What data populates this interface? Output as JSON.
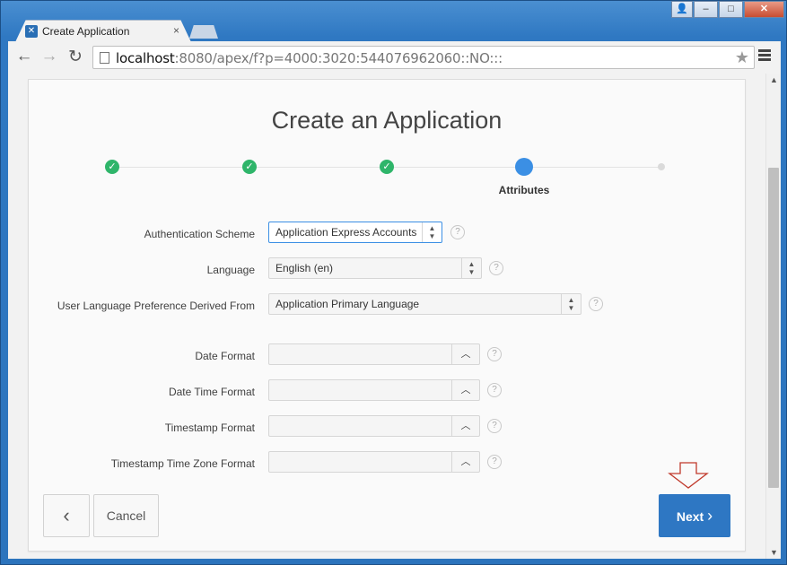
{
  "window": {
    "tab_title": "Create Application",
    "tab_close": "×",
    "controls": {
      "user": "👤",
      "minimize": "–",
      "maximize": "□",
      "close": "✕"
    }
  },
  "toolbar": {
    "back": "←",
    "forward": "→",
    "reload": "↻",
    "url_host": "localhost",
    "url_rest": ":8080/apex/f?p=4000:3020:544076962060::NO:::",
    "star": "★"
  },
  "page": {
    "title": "Create an Application",
    "wizard": {
      "steps": [
        {
          "state": "done",
          "mark": "✓"
        },
        {
          "state": "done",
          "mark": "✓"
        },
        {
          "state": "done",
          "mark": "✓"
        },
        {
          "state": "current",
          "label": "Attributes"
        },
        {
          "state": "future"
        }
      ]
    },
    "form": {
      "authentication_scheme": {
        "label": "Authentication Scheme",
        "value": "Application Express Accounts"
      },
      "language": {
        "label": "Language",
        "value": "English (en)"
      },
      "user_language_pref": {
        "label": "User Language Preference Derived From",
        "value": "Application Primary Language"
      },
      "date_format": {
        "label": "Date Format",
        "value": ""
      },
      "date_time_format": {
        "label": "Date Time Format",
        "value": ""
      },
      "timestamp_format": {
        "label": "Timestamp Format",
        "value": ""
      },
      "timestamp_tz_format": {
        "label": "Timestamp Time Zone Format",
        "value": ""
      },
      "help_glyph": "?",
      "picker_glyph": "︿"
    },
    "buttons": {
      "back_glyph": "‹",
      "cancel": "Cancel",
      "next": "Next",
      "next_glyph": "›"
    }
  },
  "colors": {
    "accent": "#2e77c3",
    "step_done": "#2fb56a",
    "step_current": "#3b8fe4",
    "annotation_arrow": "#c0392b"
  }
}
